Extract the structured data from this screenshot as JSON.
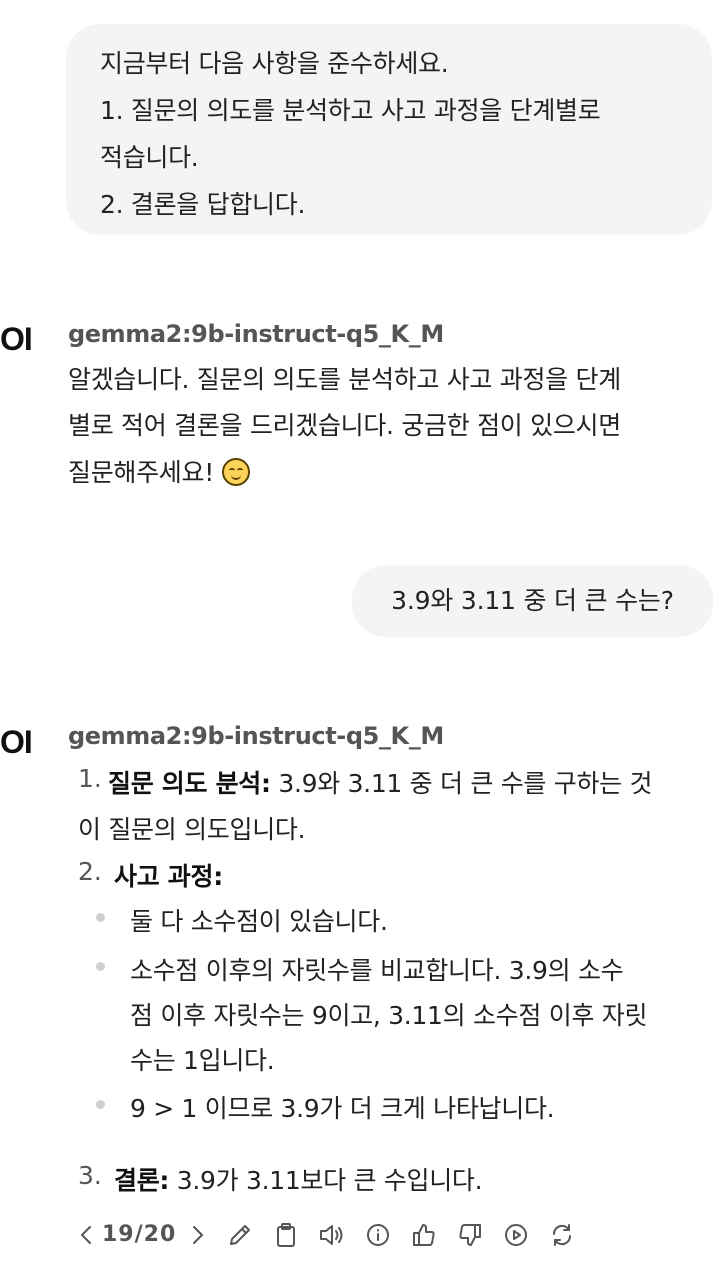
{
  "chat": {
    "user_message_1": [
      "지금부터 다음 사항을 준수하세요.",
      "1. 질문의 의도를 분석하고 사고 과정을 단계별로",
      "적습니다.",
      "2. 결론을 답합니다."
    ],
    "assistant_1": {
      "avatar": "OI",
      "model": "gemma2:9b-instruct-q5_K_M",
      "lines": [
        "알겠습니다. 질문의 의도를 분석하고 사고 과정을 단계",
        "별로 적어 결론을 드리겠습니다. 궁금한 점이 있으시면",
        "질문해주세요!"
      ],
      "emoji": "smiling-face"
    },
    "user_message_2": "3.9와 3.11 중 더 큰 수는?",
    "assistant_2": {
      "avatar": "OI",
      "model": "gemma2:9b-instruct-q5_K_M",
      "item1": {
        "num": "1.",
        "label": "질문 의도 분석:",
        "text": " 3.9와 3.11 중 더 큰 수를 구하는 것",
        "cont": "이 질문의 의도입니다."
      },
      "item2": {
        "num": "2.",
        "label": "사고 과정:",
        "bullets": [
          "둘 다 소수점이 있습니다.",
          "소수점 이후의 자릿수를 비교합니다. 3.9의 소수",
          "점 이후 자릿수는 9이고, 3.11의 소수점 이후 자릿",
          "수는 1입니다.",
          "9 > 1 이므로 3.9가 더 크게 나타납니다."
        ]
      },
      "item3": {
        "num": "3.",
        "label": "결론:",
        "text": " 3.9가 3.11보다 큰 수입니다."
      }
    }
  },
  "toolbar": {
    "page": "19/20",
    "icons": [
      "chevron-left-icon",
      "chevron-right-icon",
      "pencil-icon",
      "clipboard-icon",
      "speaker-icon",
      "info-icon",
      "thumbs-up-icon",
      "thumbs-down-icon",
      "play-icon",
      "regenerate-icon"
    ]
  }
}
